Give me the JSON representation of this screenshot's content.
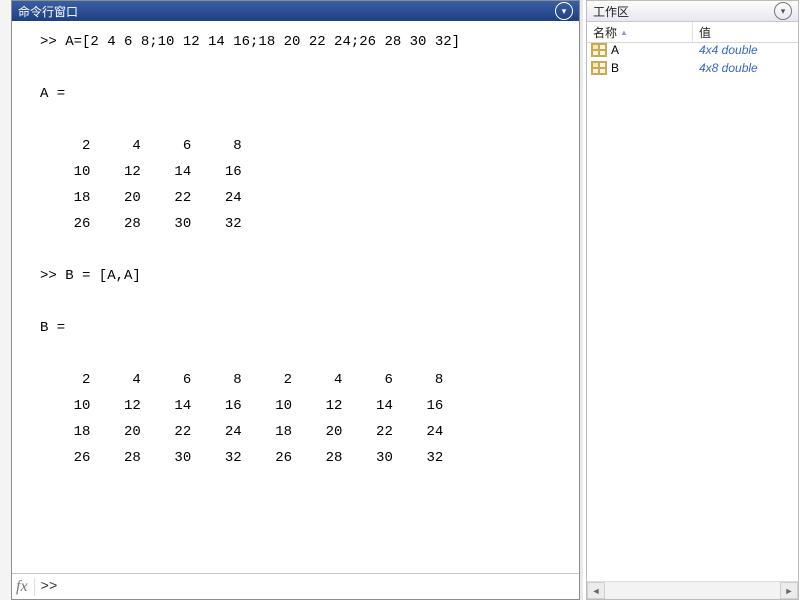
{
  "command_window": {
    "title": "命令行窗口",
    "dropdown_glyph": "▾",
    "content": ">> A=[2 4 6 8;10 12 14 16;18 20 22 24;26 28 30 32]\n\nA =\n\n     2     4     6     8\n    10    12    14    16\n    18    20    22    24\n    26    28    30    32\n\n>> B = [A,A]\n\nB =\n\n     2     4     6     8     2     4     6     8\n    10    12    14    16    10    12    14    16\n    18    20    22    24    18    20    22    24\n    26    28    30    32    26    28    30    32\n",
    "fx_label": "fx",
    "prompt": ">>"
  },
  "workspace": {
    "title": "工作区",
    "dropdown_glyph": "▾",
    "columns": {
      "name": "名称",
      "value": "值",
      "sort_glyph": "▲"
    },
    "vars": [
      {
        "name": "A",
        "value": "4x4 double"
      },
      {
        "name": "B",
        "value": "4x8 double"
      }
    ],
    "hscroll": {
      "left": "◄",
      "right": "►"
    }
  },
  "chart_data": {
    "type": "table",
    "tables": [
      {
        "name": "A",
        "rows": [
          [
            2,
            4,
            6,
            8
          ],
          [
            10,
            12,
            14,
            16
          ],
          [
            18,
            20,
            22,
            24
          ],
          [
            26,
            28,
            30,
            32
          ]
        ]
      },
      {
        "name": "B",
        "rows": [
          [
            2,
            4,
            6,
            8,
            2,
            4,
            6,
            8
          ],
          [
            10,
            12,
            14,
            16,
            10,
            12,
            14,
            16
          ],
          [
            18,
            20,
            22,
            24,
            18,
            20,
            22,
            24
          ],
          [
            26,
            28,
            30,
            32,
            26,
            28,
            30,
            32
          ]
        ]
      }
    ]
  }
}
